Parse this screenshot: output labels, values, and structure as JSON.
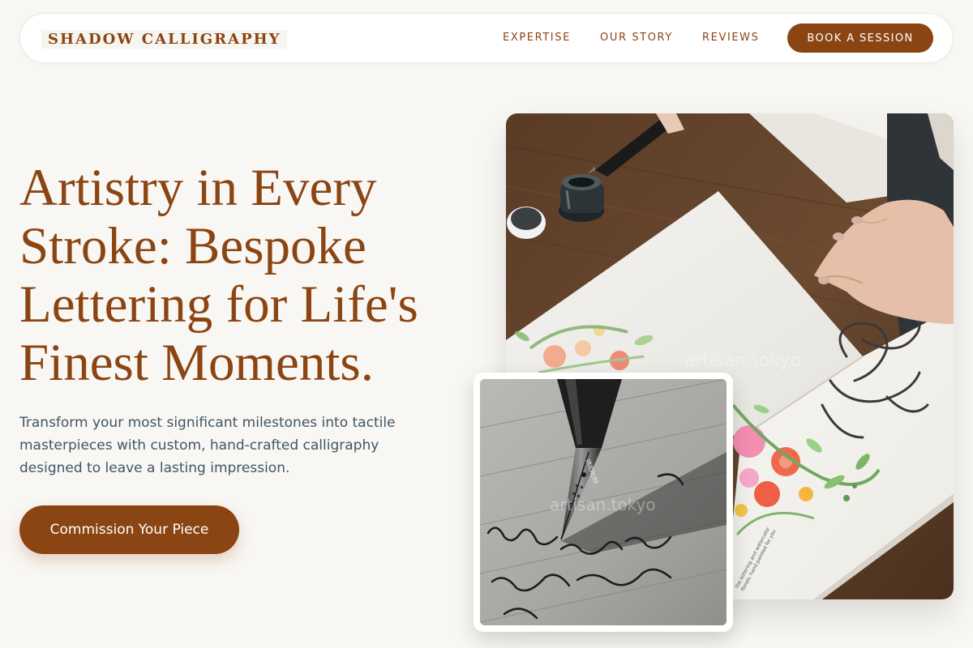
{
  "nav": {
    "brand": "SHADOW CALLIGRAPHY",
    "links": [
      "EXPERTISE",
      "OUR STORY",
      "REVIEWS"
    ],
    "cta": "BOOK A SESSION"
  },
  "hero": {
    "title_lines": [
      "Artistry in Every",
      "Stroke: Bespoke",
      "Lettering for Life's",
      "Finest Moments."
    ],
    "subtitle_lines": [
      "Transform your most significant milestones into tactile",
      "masterpieces with custom, hand-crafted calligraphy",
      "designed to leave a lasting impression."
    ],
    "cta": "Commission Your Piece"
  },
  "images": {
    "main_watermark": "artisan.tokyo",
    "inset_watermark": "artisan.tokyo"
  },
  "colors": {
    "accent": "#8b4513",
    "background": "#f9f7f3",
    "body_text": "#3f5568"
  }
}
